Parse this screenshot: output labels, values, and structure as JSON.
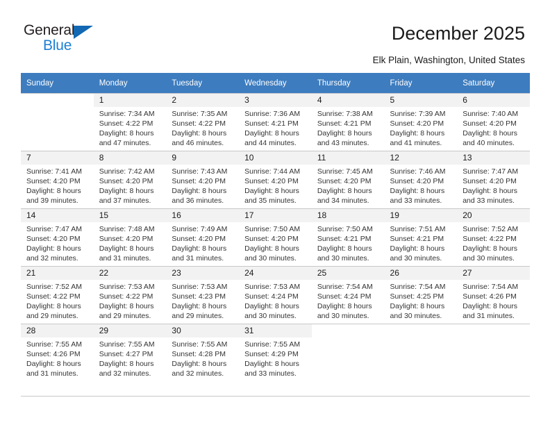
{
  "brand": {
    "name_part1": "General",
    "name_part2": "Blue",
    "triangle_icon": "triangle-icon",
    "accent_color": "#1b7fd4",
    "dark_color": "#231f20"
  },
  "header": {
    "title": "December 2025",
    "subtitle": "Elk Plain, Washington, United States"
  },
  "calendar": {
    "header_bg": "#3d7cbf",
    "daynum_bg": "#f2f2f2",
    "weekdays": [
      "Sunday",
      "Monday",
      "Tuesday",
      "Wednesday",
      "Thursday",
      "Friday",
      "Saturday"
    ],
    "weeks": [
      [
        {
          "day": "",
          "lines": []
        },
        {
          "day": "1",
          "lines": [
            "Sunrise: 7:34 AM",
            "Sunset: 4:22 PM",
            "Daylight: 8 hours",
            "and 47 minutes."
          ]
        },
        {
          "day": "2",
          "lines": [
            "Sunrise: 7:35 AM",
            "Sunset: 4:22 PM",
            "Daylight: 8 hours",
            "and 46 minutes."
          ]
        },
        {
          "day": "3",
          "lines": [
            "Sunrise: 7:36 AM",
            "Sunset: 4:21 PM",
            "Daylight: 8 hours",
            "and 44 minutes."
          ]
        },
        {
          "day": "4",
          "lines": [
            "Sunrise: 7:38 AM",
            "Sunset: 4:21 PM",
            "Daylight: 8 hours",
            "and 43 minutes."
          ]
        },
        {
          "day": "5",
          "lines": [
            "Sunrise: 7:39 AM",
            "Sunset: 4:20 PM",
            "Daylight: 8 hours",
            "and 41 minutes."
          ]
        },
        {
          "day": "6",
          "lines": [
            "Sunrise: 7:40 AM",
            "Sunset: 4:20 PM",
            "Daylight: 8 hours",
            "and 40 minutes."
          ]
        }
      ],
      [
        {
          "day": "7",
          "lines": [
            "Sunrise: 7:41 AM",
            "Sunset: 4:20 PM",
            "Daylight: 8 hours",
            "and 39 minutes."
          ]
        },
        {
          "day": "8",
          "lines": [
            "Sunrise: 7:42 AM",
            "Sunset: 4:20 PM",
            "Daylight: 8 hours",
            "and 37 minutes."
          ]
        },
        {
          "day": "9",
          "lines": [
            "Sunrise: 7:43 AM",
            "Sunset: 4:20 PM",
            "Daylight: 8 hours",
            "and 36 minutes."
          ]
        },
        {
          "day": "10",
          "lines": [
            "Sunrise: 7:44 AM",
            "Sunset: 4:20 PM",
            "Daylight: 8 hours",
            "and 35 minutes."
          ]
        },
        {
          "day": "11",
          "lines": [
            "Sunrise: 7:45 AM",
            "Sunset: 4:20 PM",
            "Daylight: 8 hours",
            "and 34 minutes."
          ]
        },
        {
          "day": "12",
          "lines": [
            "Sunrise: 7:46 AM",
            "Sunset: 4:20 PM",
            "Daylight: 8 hours",
            "and 33 minutes."
          ]
        },
        {
          "day": "13",
          "lines": [
            "Sunrise: 7:47 AM",
            "Sunset: 4:20 PM",
            "Daylight: 8 hours",
            "and 33 minutes."
          ]
        }
      ],
      [
        {
          "day": "14",
          "lines": [
            "Sunrise: 7:47 AM",
            "Sunset: 4:20 PM",
            "Daylight: 8 hours",
            "and 32 minutes."
          ]
        },
        {
          "day": "15",
          "lines": [
            "Sunrise: 7:48 AM",
            "Sunset: 4:20 PM",
            "Daylight: 8 hours",
            "and 31 minutes."
          ]
        },
        {
          "day": "16",
          "lines": [
            "Sunrise: 7:49 AM",
            "Sunset: 4:20 PM",
            "Daylight: 8 hours",
            "and 31 minutes."
          ]
        },
        {
          "day": "17",
          "lines": [
            "Sunrise: 7:50 AM",
            "Sunset: 4:20 PM",
            "Daylight: 8 hours",
            "and 30 minutes."
          ]
        },
        {
          "day": "18",
          "lines": [
            "Sunrise: 7:50 AM",
            "Sunset: 4:21 PM",
            "Daylight: 8 hours",
            "and 30 minutes."
          ]
        },
        {
          "day": "19",
          "lines": [
            "Sunrise: 7:51 AM",
            "Sunset: 4:21 PM",
            "Daylight: 8 hours",
            "and 30 minutes."
          ]
        },
        {
          "day": "20",
          "lines": [
            "Sunrise: 7:52 AM",
            "Sunset: 4:22 PM",
            "Daylight: 8 hours",
            "and 30 minutes."
          ]
        }
      ],
      [
        {
          "day": "21",
          "lines": [
            "Sunrise: 7:52 AM",
            "Sunset: 4:22 PM",
            "Daylight: 8 hours",
            "and 29 minutes."
          ]
        },
        {
          "day": "22",
          "lines": [
            "Sunrise: 7:53 AM",
            "Sunset: 4:22 PM",
            "Daylight: 8 hours",
            "and 29 minutes."
          ]
        },
        {
          "day": "23",
          "lines": [
            "Sunrise: 7:53 AM",
            "Sunset: 4:23 PM",
            "Daylight: 8 hours",
            "and 29 minutes."
          ]
        },
        {
          "day": "24",
          "lines": [
            "Sunrise: 7:53 AM",
            "Sunset: 4:24 PM",
            "Daylight: 8 hours",
            "and 30 minutes."
          ]
        },
        {
          "day": "25",
          "lines": [
            "Sunrise: 7:54 AM",
            "Sunset: 4:24 PM",
            "Daylight: 8 hours",
            "and 30 minutes."
          ]
        },
        {
          "day": "26",
          "lines": [
            "Sunrise: 7:54 AM",
            "Sunset: 4:25 PM",
            "Daylight: 8 hours",
            "and 30 minutes."
          ]
        },
        {
          "day": "27",
          "lines": [
            "Sunrise: 7:54 AM",
            "Sunset: 4:26 PM",
            "Daylight: 8 hours",
            "and 31 minutes."
          ]
        }
      ],
      [
        {
          "day": "28",
          "lines": [
            "Sunrise: 7:55 AM",
            "Sunset: 4:26 PM",
            "Daylight: 8 hours",
            "and 31 minutes."
          ]
        },
        {
          "day": "29",
          "lines": [
            "Sunrise: 7:55 AM",
            "Sunset: 4:27 PM",
            "Daylight: 8 hours",
            "and 32 minutes."
          ]
        },
        {
          "day": "30",
          "lines": [
            "Sunrise: 7:55 AM",
            "Sunset: 4:28 PM",
            "Daylight: 8 hours",
            "and 32 minutes."
          ]
        },
        {
          "day": "31",
          "lines": [
            "Sunrise: 7:55 AM",
            "Sunset: 4:29 PM",
            "Daylight: 8 hours",
            "and 33 minutes."
          ]
        },
        {
          "day": "",
          "lines": []
        },
        {
          "day": "",
          "lines": []
        },
        {
          "day": "",
          "lines": []
        }
      ]
    ]
  }
}
